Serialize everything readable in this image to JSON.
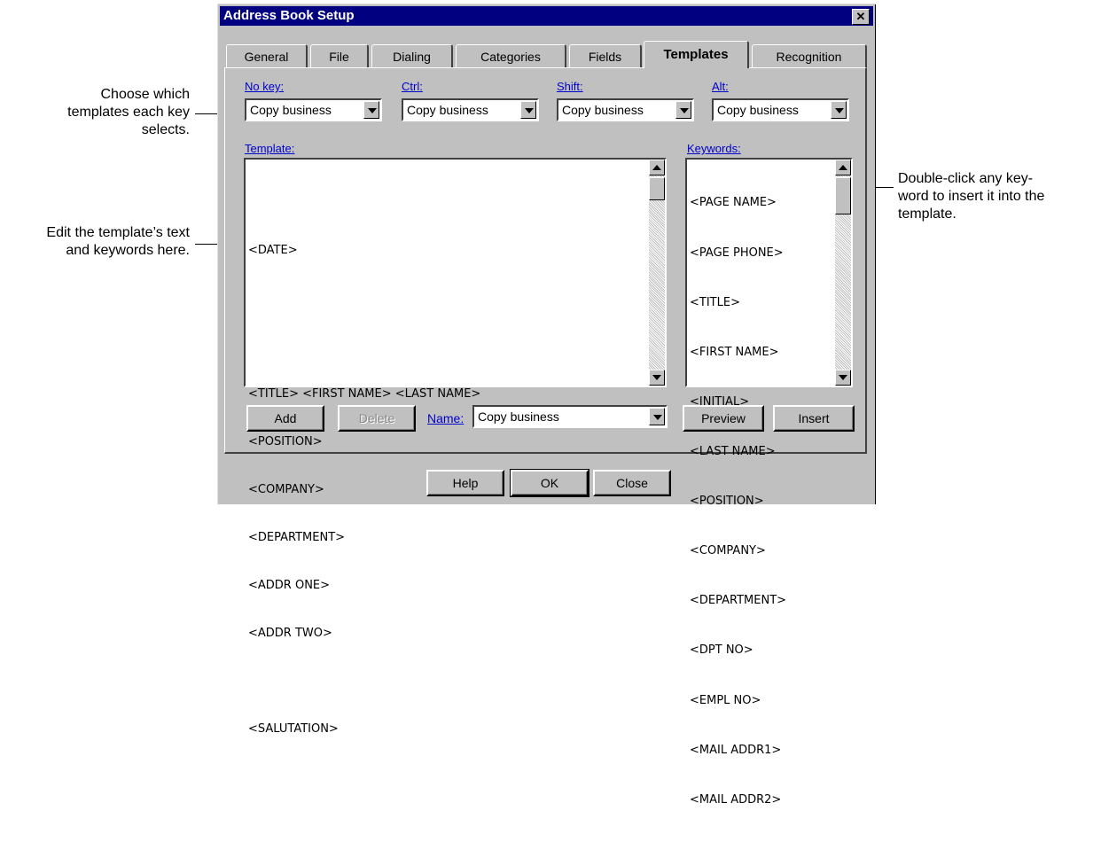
{
  "callouts": {
    "left_top": [
      "Choose which",
      "templates each key",
      "selects."
    ],
    "left_mid": [
      "Edit the template’s text",
      "and keywords here."
    ],
    "right": [
      "Double-click any key-",
      "word to insert it into the",
      "template."
    ]
  },
  "dialog": {
    "title": "Address Book Setup",
    "close_glyph": "✕"
  },
  "tabs": [
    "General",
    "File",
    "Dialing",
    "Categories",
    "Fields",
    "Templates",
    "Recognition"
  ],
  "active_tab": "Templates",
  "keys": {
    "no_key_label": "No key:",
    "ctrl_label": "Ctrl:",
    "shift_label": "Shift:",
    "alt_label": "Alt:",
    "no_key_value": "Copy business",
    "ctrl_value": "Copy business",
    "shift_value": "Copy business",
    "alt_value": "Copy business"
  },
  "template": {
    "label": "Template:",
    "lines": [
      "",
      "<DATE>",
      "",
      "",
      "<TITLE> <FIRST NAME> <LAST NAME>",
      "<POSITION>",
      "<COMPANY>",
      "<DEPARTMENT>",
      "<ADDR ONE>",
      "<ADDR TWO>",
      "",
      "<SALUTATION>"
    ]
  },
  "keywords": {
    "label": "Keywords:",
    "items": [
      "<PAGE NAME>",
      "<PAGE PHONE>",
      "<TITLE>",
      "<FIRST NAME>",
      "<INITIAL>",
      "<LAST NAME>",
      "<POSITION>",
      "<COMPANY>",
      "<DEPARTMENT>",
      "<DPT NO>",
      "<EMPL NO>",
      "<MAIL ADDR1>",
      "<MAIL ADDR2>"
    ]
  },
  "actions": {
    "add": "Add",
    "delete": "Delete",
    "name_label": "Name:",
    "name_value": "Copy business",
    "preview": "Preview",
    "insert": "Insert"
  },
  "footer": {
    "help": "Help",
    "ok": "OK",
    "close": "Close"
  }
}
